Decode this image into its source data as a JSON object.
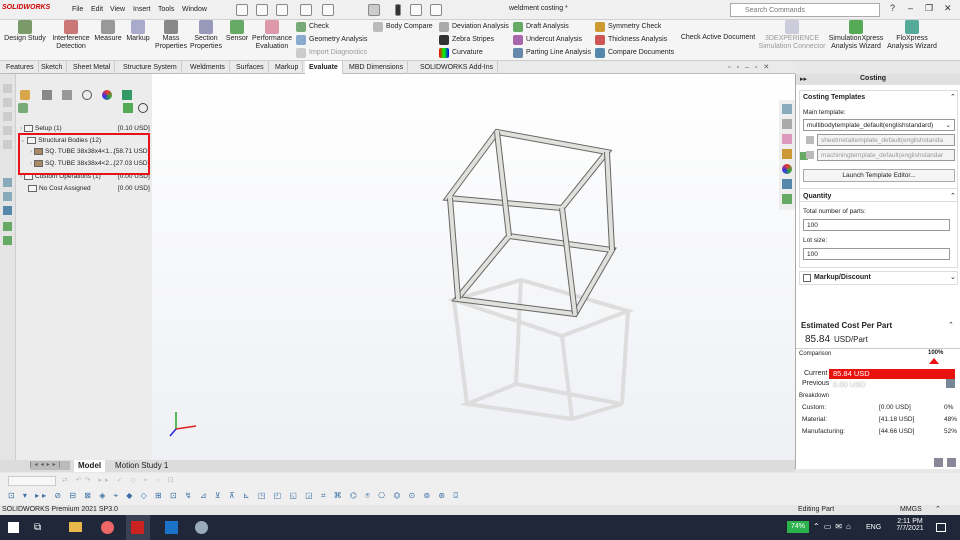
{
  "app": {
    "logo": "SOLIDWORKS",
    "menu": [
      "File",
      "Edit",
      "View",
      "Insert",
      "Tools",
      "Window"
    ],
    "doc_title": "weldment costing *",
    "search_placeholder": "Search Commands"
  },
  "ribbon": {
    "buttons": [
      "Design Study",
      "Interference Detection",
      "Measure",
      "Markup",
      "Mass Properties",
      "Section Properties",
      "Sensor",
      "Performance Evaluation"
    ],
    "col1": [
      "Check",
      "Geometry Analysis",
      "Import Diagnostics"
    ],
    "col2": [
      "Body Compare"
    ],
    "col3": [
      "Deviation Analysis",
      "Zebra Stripes",
      "Curvature"
    ],
    "col4": [
      "Draft Analysis",
      "Undercut Analysis",
      "Parting Line Analysis"
    ],
    "col5": [
      "Symmetry Check",
      "Thickness Analysis",
      "Compare Documents"
    ],
    "check_active": "Check Active Document",
    "right": [
      "3DEXPERIENCE Simulation Connector",
      "SimulationXpress Analysis Wizard",
      "FloXpress Analysis Wizard"
    ]
  },
  "tabs": [
    "Features",
    "Sketch",
    "Sheet Metal",
    "Structure System",
    "Weldments",
    "Surfaces",
    "Markup",
    "Evaluate",
    "MBD Dimensions",
    "SOLIDWORKS Add-Ins"
  ],
  "active_tab": "Evaluate",
  "tree": {
    "setup": {
      "label": "Setup (1)",
      "cost": "[0.10 USD]"
    },
    "structural": {
      "label": "Structural Bodies (12)"
    },
    "tube1": {
      "label": "SQ. TUBE 38x38x4<1...",
      "cost": "[58.71 USD]"
    },
    "tube2": {
      "label": "SQ. TUBE 38x38x4<2...",
      "cost": "[27.03 USD]"
    },
    "custom": {
      "label": "Custom Operations (1)",
      "cost": "[0.00 USD]"
    },
    "nocost": {
      "label": "No Cost Assigned",
      "cost": "[0.00 USD]"
    }
  },
  "costing": {
    "title": "Costing",
    "templates_hdr": "Costing Templates",
    "main_template_label": "Main template:",
    "main_template": "multibodytemplate_default(englishstandard)",
    "sheetmetal": "sheetmetaltemplate_default(englishstanda",
    "machining": "machiningtemplate_default(englishstandar",
    "launch": "Launch Template Editor...",
    "quantity_hdr": "Quantity",
    "total_parts_label": "Total number of parts:",
    "total_parts": "100",
    "lot_label": "Lot size:",
    "lot": "100",
    "markup_hdr": "Markup/Discount",
    "est_hdr": "Estimated Cost Per Part",
    "est_value": "85.84",
    "est_unit": "USD/Part",
    "comparison": "Comparison",
    "pct": "100%",
    "current_label": "Current",
    "current_value": "85.84 USD",
    "previous_label": "Previous",
    "previous_value": "0.00 USD",
    "breakdown": "Breakdown",
    "rows": [
      {
        "label": "Custom:",
        "value": "[0.00 USD]",
        "pct": "0%"
      },
      {
        "label": "Material:",
        "value": "[41.18 USD]",
        "pct": "48%"
      },
      {
        "label": "Manufacturing:",
        "value": "[44.66 USD]",
        "pct": "52%"
      }
    ]
  },
  "bottom_tabs": [
    "Model",
    "Motion Study 1"
  ],
  "status": {
    "left": "SOLIDWORKS Premium 2021 SP3.0",
    "mid": "Editing Part",
    "units": "MMGS"
  },
  "taskbar": {
    "battery": "74%",
    "lang": "ENG",
    "time": "2:11 PM",
    "date": "7/7/2021"
  },
  "colors": {
    "accent_red": "#e8130f",
    "highlight_box": "#e8121a"
  }
}
